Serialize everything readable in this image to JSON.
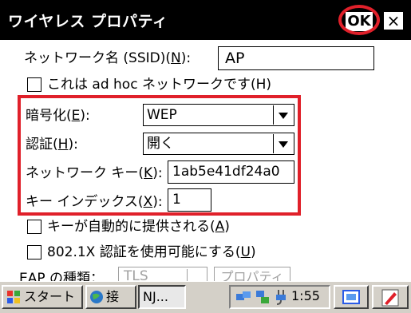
{
  "window": {
    "title": "ワイヤレス プロパティ",
    "ok_label": "OK",
    "close_label": "×"
  },
  "network_name": {
    "label_prefix": "ネットワーク名 (SSID)(",
    "accel": "N",
    "label_suffix": "):",
    "value": "AP"
  },
  "adhoc": {
    "label": "これは ad hoc ネットワークです(H)",
    "checked": false
  },
  "encryption": {
    "label_prefix": "暗号化(",
    "accel": "E",
    "label_suffix": "):",
    "value": "WEP"
  },
  "authentication": {
    "label_prefix": "認証(",
    "accel": "H",
    "label_suffix": "):",
    "value": "開く"
  },
  "network_key": {
    "label_prefix": "ネットワーク キー(",
    "accel": "K",
    "label_suffix": "):",
    "value": "1ab5e41df24a0"
  },
  "key_index": {
    "label_prefix": "キー インデックス(",
    "accel": "X",
    "label_suffix": "):",
    "value": "1"
  },
  "auto_key": {
    "label_prefix": "キーが自動的に提供される(",
    "accel": "A",
    "label_suffix": ")",
    "checked": false
  },
  "ieee8021x": {
    "label_prefix": "802.1X 認証を使用可能にする(",
    "accel": "U",
    "label_suffix": ")",
    "checked": false
  },
  "eap": {
    "label": "EAP の種類：",
    "value": "TLS",
    "properties_label": "プロパティ(P)"
  },
  "taskbar": {
    "start_label": "スタート",
    "app1_label": "接",
    "app2_label": "NJ...",
    "clock": "1:55"
  },
  "colors": {
    "highlight": "#e0202a",
    "titlebar": "#000000",
    "taskbar": "#d4d0c8"
  }
}
